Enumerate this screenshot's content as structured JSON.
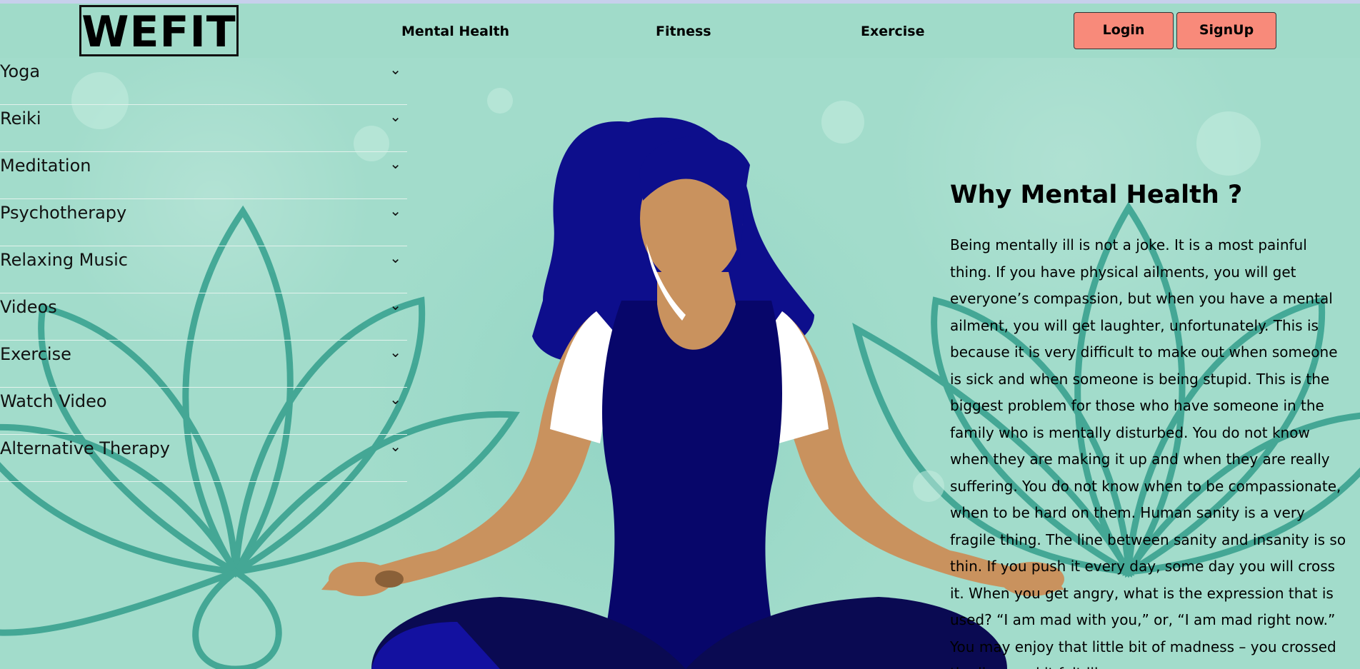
{
  "brand": {
    "logo": "WEFIT"
  },
  "nav": {
    "links": [
      "Mental Health",
      "Fitness",
      "Exercise"
    ],
    "login": "Login",
    "signup": "SignUp"
  },
  "sidebar": {
    "items": [
      {
        "label": "Yoga"
      },
      {
        "label": "Reiki"
      },
      {
        "label": "Meditation"
      },
      {
        "label": "Psychotherapy"
      },
      {
        "label": "Relaxing Music"
      },
      {
        "label": "Videos"
      },
      {
        "label": "Exercise"
      },
      {
        "label": "Watch Video"
      },
      {
        "label": "Alternative Therapy"
      }
    ]
  },
  "article": {
    "title": "Why Mental Health ?",
    "body": "Being mentally ill is not a joke. It is a most painful thing. If you have physical ailments, you will get everyone’s compassion, but when you have a mental ailment, you will get laughter, unfortunately. This is because it is very difficult to make out when someone is sick and when someone is being stupid. This is the biggest problem for those who have someone in the family who is mentally disturbed. You do not know when they are making it up and when they are really suffering. You do not know when to be compassionate, when to be hard on them. Human sanity is a very fragile thing. The line between sanity and insanity is so thin. If you push it every day, some day you will cross it. When you get angry, what is the expression that is used? “I am mad with you,” or, “I am mad right now.” You may enjoy that little bit of madness – you crossed the line, and it felt like some"
  },
  "colors": {
    "navbar": "#a0dbc9",
    "background": "#a2dccb",
    "button": "#f88a7a",
    "lotus": "#3fa593",
    "hair": "#0d0e8c",
    "outfit": "#07066a",
    "skin": "#c9925e"
  }
}
